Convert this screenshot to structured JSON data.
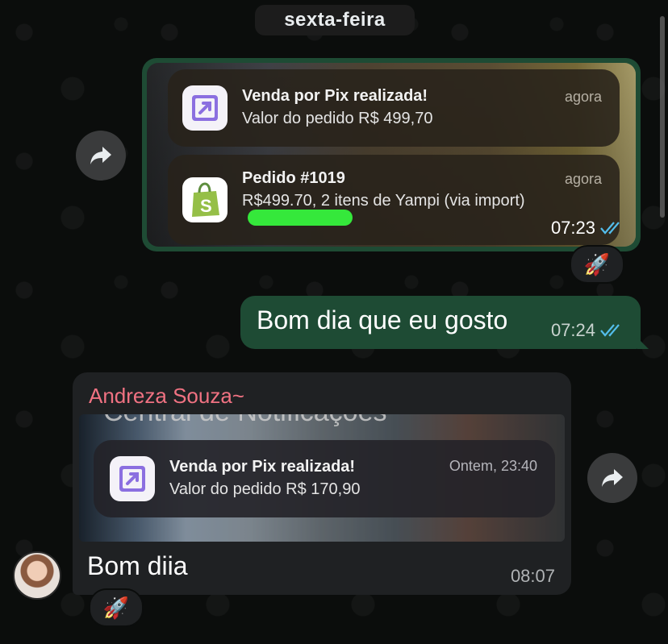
{
  "date_separator": "sexta-feira",
  "messages": {
    "outgoing_image": {
      "notifications": [
        {
          "app_icon": "pix-arrow-icon",
          "title": "Venda por Pix realizada!",
          "body": "Valor do pedido R$ 499,70",
          "when": "agora"
        },
        {
          "app_icon": "shopify-bag-icon",
          "title": "Pedido #1019",
          "body": "R$499.70, 2 itens de Yampi (via import)",
          "when": "agora"
        }
      ],
      "time": "07:23",
      "reaction": "🚀"
    },
    "outgoing_text": {
      "text": "Bom dia que eu gosto",
      "time": "07:24"
    },
    "incoming": {
      "sender": "Andreza Souza~",
      "image_partial_text": "Central de Notificações",
      "notification": {
        "app_icon": "pix-arrow-icon",
        "title": "Venda por Pix realizada!",
        "body": "Valor do pedido R$ 170,90",
        "when": "Ontem, 23:40"
      },
      "text": "Bom diia",
      "time": "08:07",
      "reaction": "🚀"
    }
  },
  "colors": {
    "outgoing_bubble": "#1e4b34",
    "incoming_bubble": "#1f2123",
    "sender_name": "#f07282",
    "read_ticks": "#53bdeb",
    "background": "#0b0d0c"
  }
}
